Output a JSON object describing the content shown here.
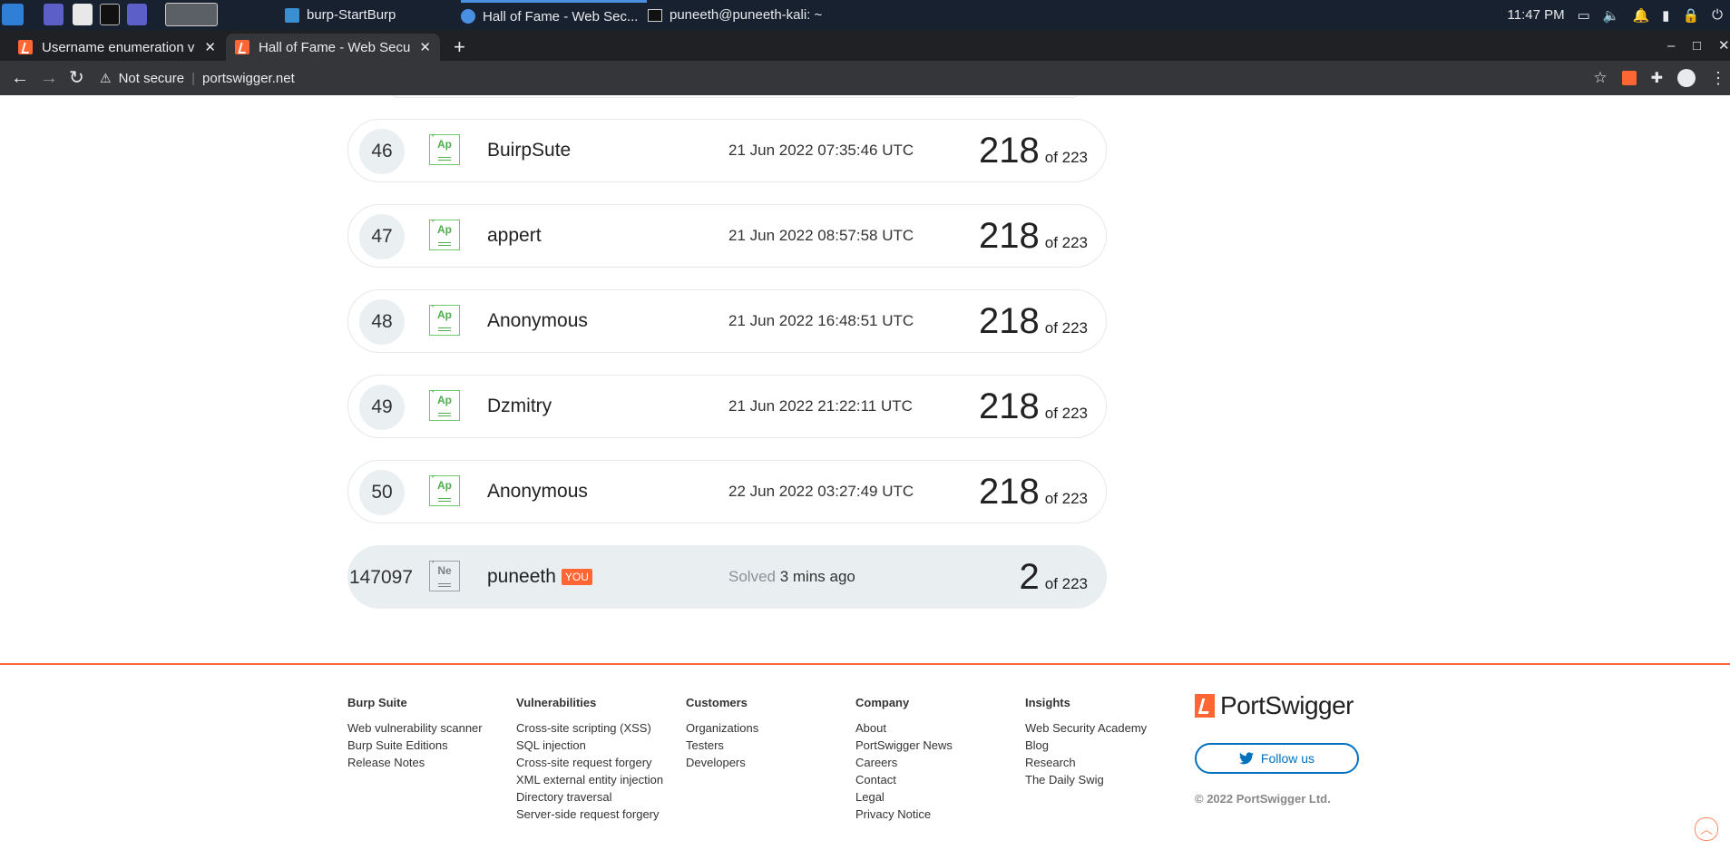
{
  "taskbar": {
    "windows": [
      {
        "label": "burp-StartBurp"
      },
      {
        "label": "Hall of Fame - Web Sec..."
      },
      {
        "label": "puneeth@puneeth-kali: ~"
      }
    ],
    "clock": "11:47 PM"
  },
  "browser": {
    "tabs": [
      {
        "title": "Username enumeration vi"
      },
      {
        "title": "Hall of Fame - Web Securi"
      }
    ],
    "address": {
      "security": "Not secure",
      "url": "portswigger.net"
    }
  },
  "leaderboard": {
    "rows": [
      {
        "rank": "46",
        "badge": "Ap",
        "name": "BuirpSute",
        "date": "21 Jun 2022 07:35:46 UTC",
        "score": "218",
        "of": "of 223"
      },
      {
        "rank": "47",
        "badge": "Ap",
        "name": "appert",
        "date": "21 Jun 2022 08:57:58 UTC",
        "score": "218",
        "of": "of 223"
      },
      {
        "rank": "48",
        "badge": "Ap",
        "name": "Anonymous",
        "date": "21 Jun 2022 16:48:51 UTC",
        "score": "218",
        "of": "of 223"
      },
      {
        "rank": "49",
        "badge": "Ap",
        "name": "Dzmitry",
        "date": "21 Jun 2022 21:22:11 UTC",
        "score": "218",
        "of": "of 223"
      },
      {
        "rank": "50",
        "badge": "Ap",
        "name": "Anonymous",
        "date": "22 Jun 2022 03:27:49 UTC",
        "score": "218",
        "of": "of 223"
      }
    ],
    "you": {
      "rank": "147097",
      "badge": "Ne",
      "name": "puneeth",
      "tag": "YOU",
      "solved_label": "Solved",
      "solved_time": "3 mins ago",
      "score": "2",
      "of": "of 223"
    }
  },
  "footer": {
    "columns": [
      {
        "heading": "Burp Suite",
        "links": [
          "Web vulnerability scanner",
          "Burp Suite Editions",
          "Release Notes"
        ]
      },
      {
        "heading": "Vulnerabilities",
        "links": [
          "Cross-site scripting (XSS)",
          "SQL injection",
          "Cross-site request forgery",
          "XML external entity injection",
          "Directory traversal",
          "Server-side request forgery"
        ]
      },
      {
        "heading": "Customers",
        "links": [
          "Organizations",
          "Testers",
          "Developers"
        ]
      },
      {
        "heading": "Company",
        "links": [
          "About",
          "PortSwigger News",
          "Careers",
          "Contact",
          "Legal",
          "Privacy Notice"
        ]
      },
      {
        "heading": "Insights",
        "links": [
          "Web Security Academy",
          "Blog",
          "Research",
          "The Daily Swig"
        ]
      }
    ],
    "brand": "PortSwigger",
    "follow": "Follow us",
    "copyright": "© 2022 PortSwigger Ltd."
  },
  "colors": {
    "accent": "#ff6633",
    "badge_green": "#4cae4c",
    "twitter_blue": "#0071bc"
  }
}
